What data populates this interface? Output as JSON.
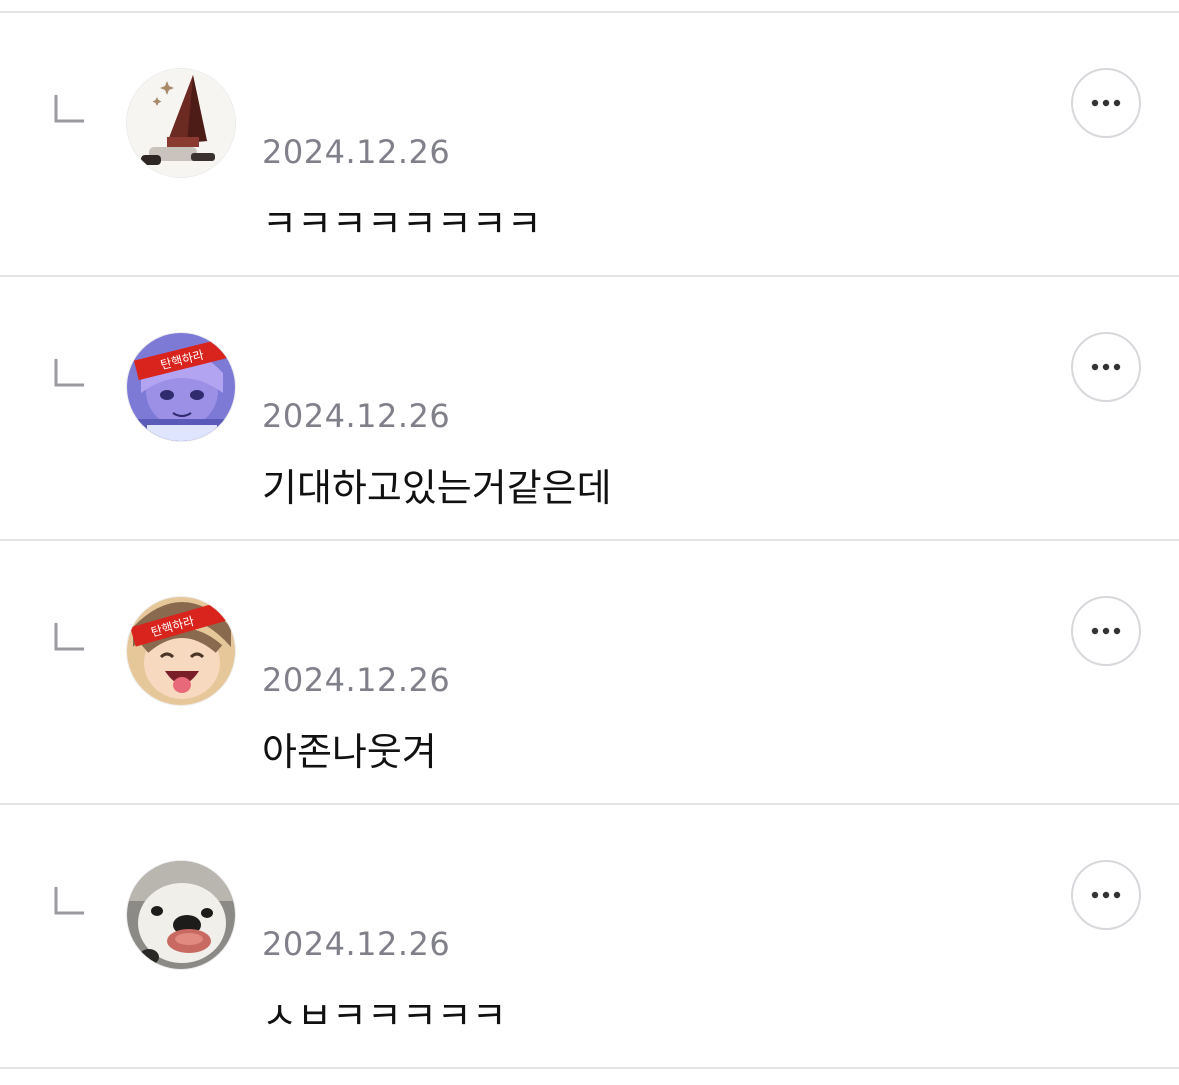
{
  "comments": [
    {
      "date": "2024.12.26",
      "text": "ㅋㅋㅋㅋㅋㅋㅋㅋ",
      "avatar": "pyramid-head-avatar"
    },
    {
      "date": "2024.12.26",
      "text": "기대하고있는거같은데",
      "avatar": "anime-girl-headband-avatar",
      "headband": "탄핵하라"
    },
    {
      "date": "2024.12.26",
      "text": "아존나웃겨",
      "avatar": "anime-boy-headband-avatar",
      "headband": "탄핵하라"
    },
    {
      "date": "2024.12.26",
      "text": "ㅅㅂㅋㅋㅋㅋㅋ",
      "avatar": "puppy-avatar"
    }
  ],
  "icons": {
    "reply": "reply-arrow-icon",
    "more": "more-options-icon"
  },
  "colors": {
    "divider": "#e3e3e6",
    "date": "#80808a",
    "text": "#111111",
    "icon": "#9a9aa0"
  }
}
